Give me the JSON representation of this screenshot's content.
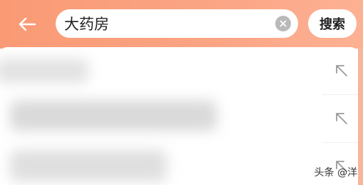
{
  "header": {
    "back_icon": "arrow-left-icon",
    "search": {
      "value": "大药房",
      "clear_icon": "clear-x-icon"
    },
    "search_button_label": "搜索"
  },
  "suggestions": [
    {
      "text": "",
      "fill_icon": "arrow-up-left-icon"
    },
    {
      "text": "",
      "fill_icon": "arrow-up-left-icon"
    },
    {
      "text": "",
      "fill_icon": "arrow-up-left-icon"
    }
  ],
  "watermark": "头条 @洋",
  "colors": {
    "header_gradient_start": "#f99a74",
    "header_gradient_end": "#fdb193",
    "clear_button": "#b9b9b9",
    "icon_gray": "#9a9a9a"
  }
}
